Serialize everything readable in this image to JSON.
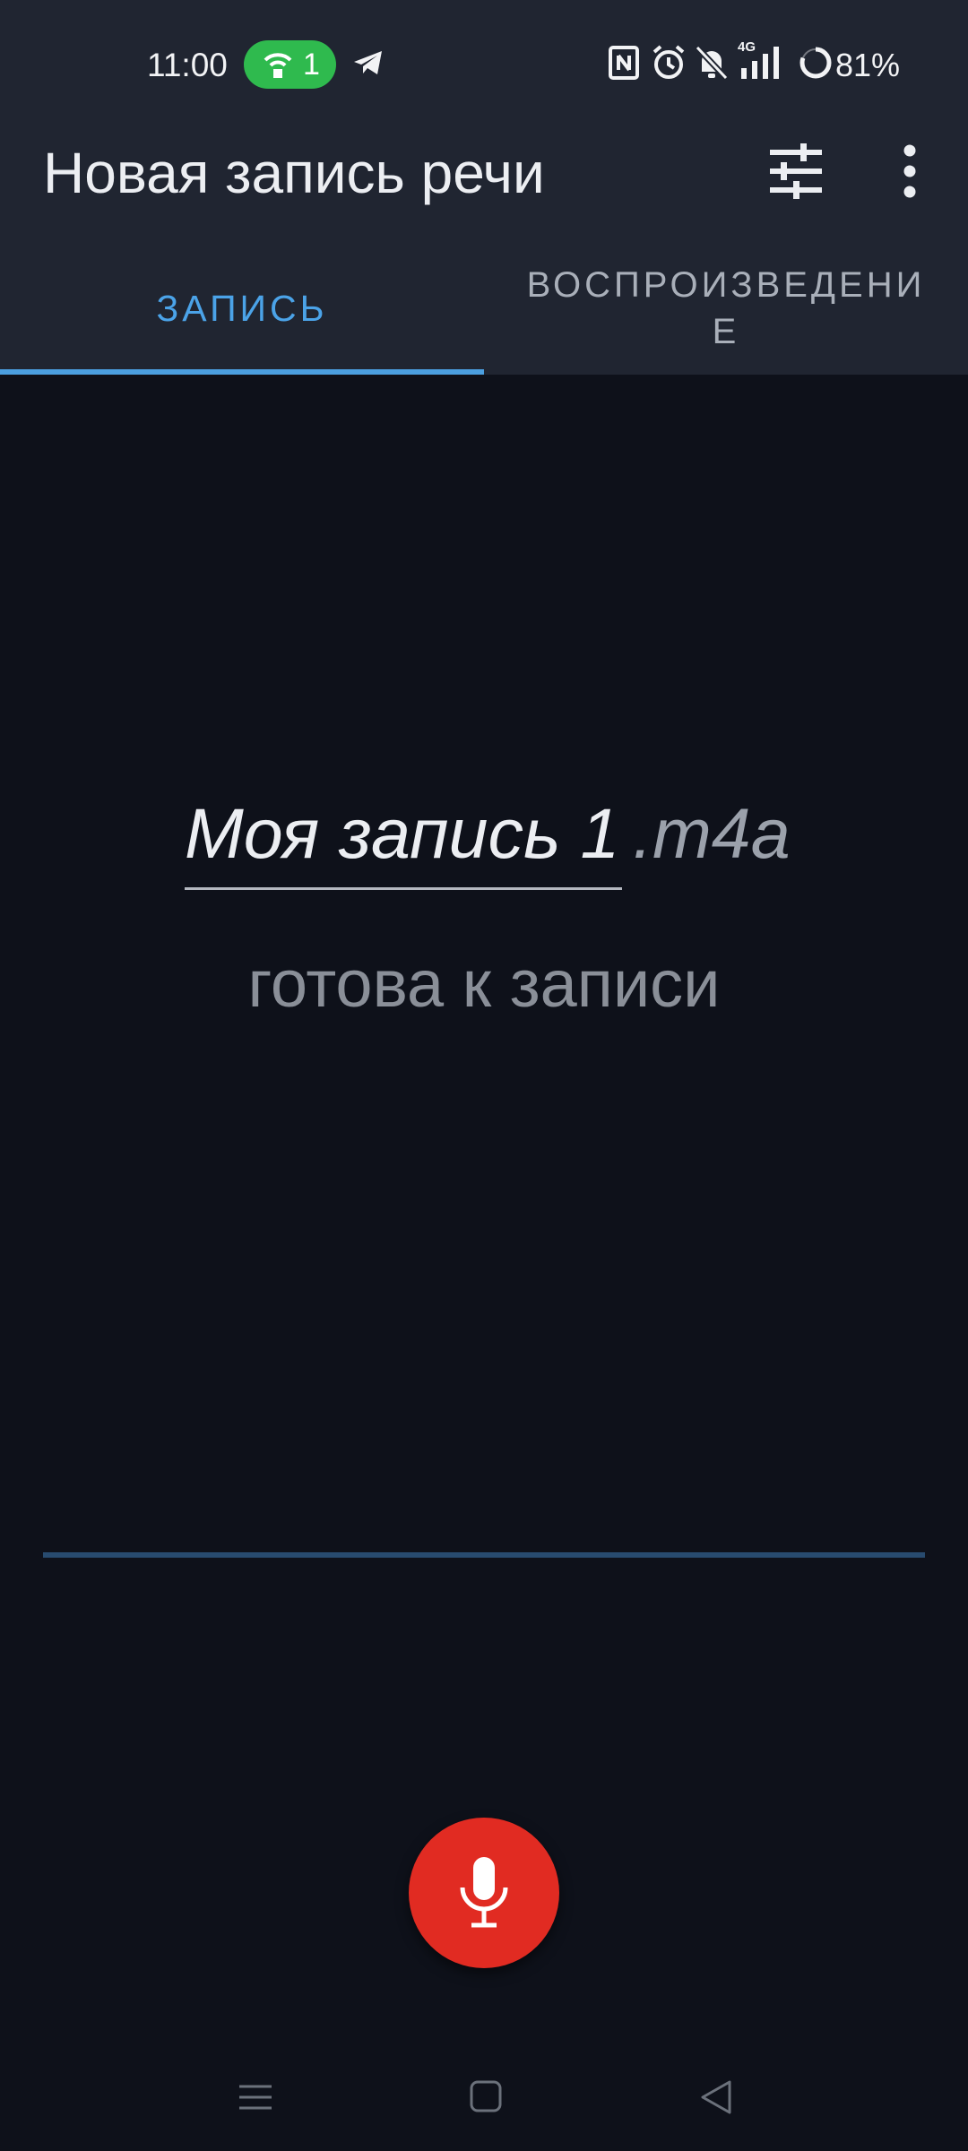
{
  "status_bar": {
    "time": "11:00",
    "hotspot_count": "1",
    "network_label": "4G",
    "battery": "81%",
    "icons": [
      "hotspot-icon",
      "telegram-icon",
      "nfc-icon",
      "alarm-icon",
      "bell-off-icon",
      "signal-icon",
      "battery-ring-icon"
    ],
    "hotspot_color": "#2fba4e"
  },
  "app_bar": {
    "title": "Новая запись речи",
    "icons": [
      "tune-icon",
      "more-vert-icon"
    ]
  },
  "tabs": [
    {
      "label": "ЗАПИСЬ",
      "selected": true
    },
    {
      "label": "ВОСПРОИЗВЕДЕНИ Е",
      "selected": false
    }
  ],
  "recording": {
    "filename": "Моя запись 1",
    "extension": ".m4a",
    "status": "готова к записи"
  },
  "colors": {
    "accent": "#4ba3e8",
    "record_button": "#e12b22",
    "background": "#0e111a",
    "bar_background": "#202531"
  },
  "nav": [
    "recent-apps-icon",
    "home-icon",
    "back-icon"
  ]
}
